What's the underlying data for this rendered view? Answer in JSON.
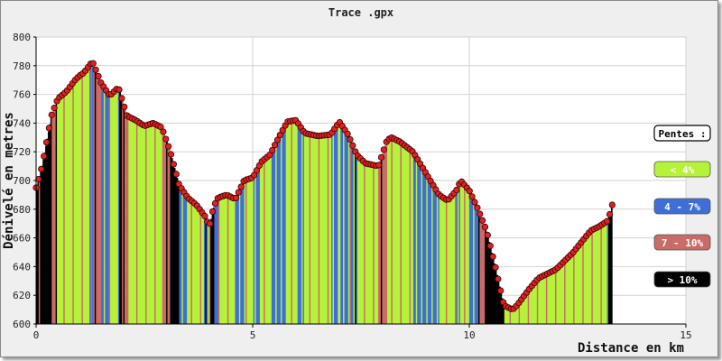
{
  "chart_data": {
    "type": "area",
    "title": "Trace .gpx",
    "xlabel": "Distance en km",
    "ylabel": "Dénivelé en metres",
    "xlim": [
      0,
      15
    ],
    "ylim": [
      600,
      800
    ],
    "x_ticks": [
      "0",
      "5",
      "10",
      "15"
    ],
    "y_ticks": [
      "600",
      "620",
      "640",
      "660",
      "680",
      "700",
      "720",
      "740",
      "760",
      "780",
      "800"
    ],
    "grid": true,
    "legend_position": "right",
    "legend": {
      "title": "Pentes :",
      "items": [
        {
          "label": "< 4%",
          "color": "#b5f23a",
          "text_color": "#ffffff"
        },
        {
          "label": "4 - 7%",
          "color": "#3f6fd6",
          "text_color": "#ffffff"
        },
        {
          "label": "7 - 10%",
          "color": "#c96b66",
          "text_color": "#ffffff"
        },
        {
          "label": "> 10%",
          "color": "#000000",
          "text_color": "#ffffff"
        }
      ]
    },
    "marker_color": "#dd2222",
    "series": [
      {
        "x": [
          0.0,
          0.1,
          0.2,
          0.35,
          0.5,
          0.7,
          0.9,
          1.0,
          1.1,
          1.3,
          1.5,
          1.7,
          1.9,
          2.1,
          2.3,
          2.5,
          2.7,
          2.9,
          3.1,
          3.3,
          3.5,
          3.7,
          3.9,
          4.0,
          4.1,
          4.2,
          4.4,
          4.6,
          4.8,
          5.0,
          5.2,
          5.4,
          5.6,
          5.8,
          6.0,
          6.2,
          6.5,
          6.8,
          7.0,
          7.2,
          7.4,
          7.6,
          7.9,
          8.1,
          8.2,
          8.4,
          8.7,
          8.9,
          9.1,
          9.3,
          9.5,
          9.7,
          9.8,
          10.0,
          10.2,
          10.4,
          10.6,
          10.8,
          11.0,
          11.1,
          11.2,
          11.4,
          11.6,
          12.0,
          12.4,
          12.8,
          13.0,
          13.2,
          13.3
        ],
        "y": [
          695,
          705,
          720,
          745,
          757,
          762,
          770,
          773,
          775,
          783,
          768,
          759,
          765,
          745,
          742,
          738,
          740,
          737,
          720,
          697,
          688,
          683,
          675,
          668,
          682,
          688,
          690,
          687,
          700,
          702,
          713,
          718,
          730,
          741,
          742,
          733,
          731,
          732,
          741,
          732,
          718,
          712,
          710,
          728,
          730,
          727,
          720,
          710,
          700,
          690,
          686,
          693,
          700,
          693,
          680,
          665,
          640,
          613,
          610,
          613,
          617,
          625,
          632,
          638,
          650,
          665,
          668,
          672,
          683
        ]
      }
    ]
  }
}
